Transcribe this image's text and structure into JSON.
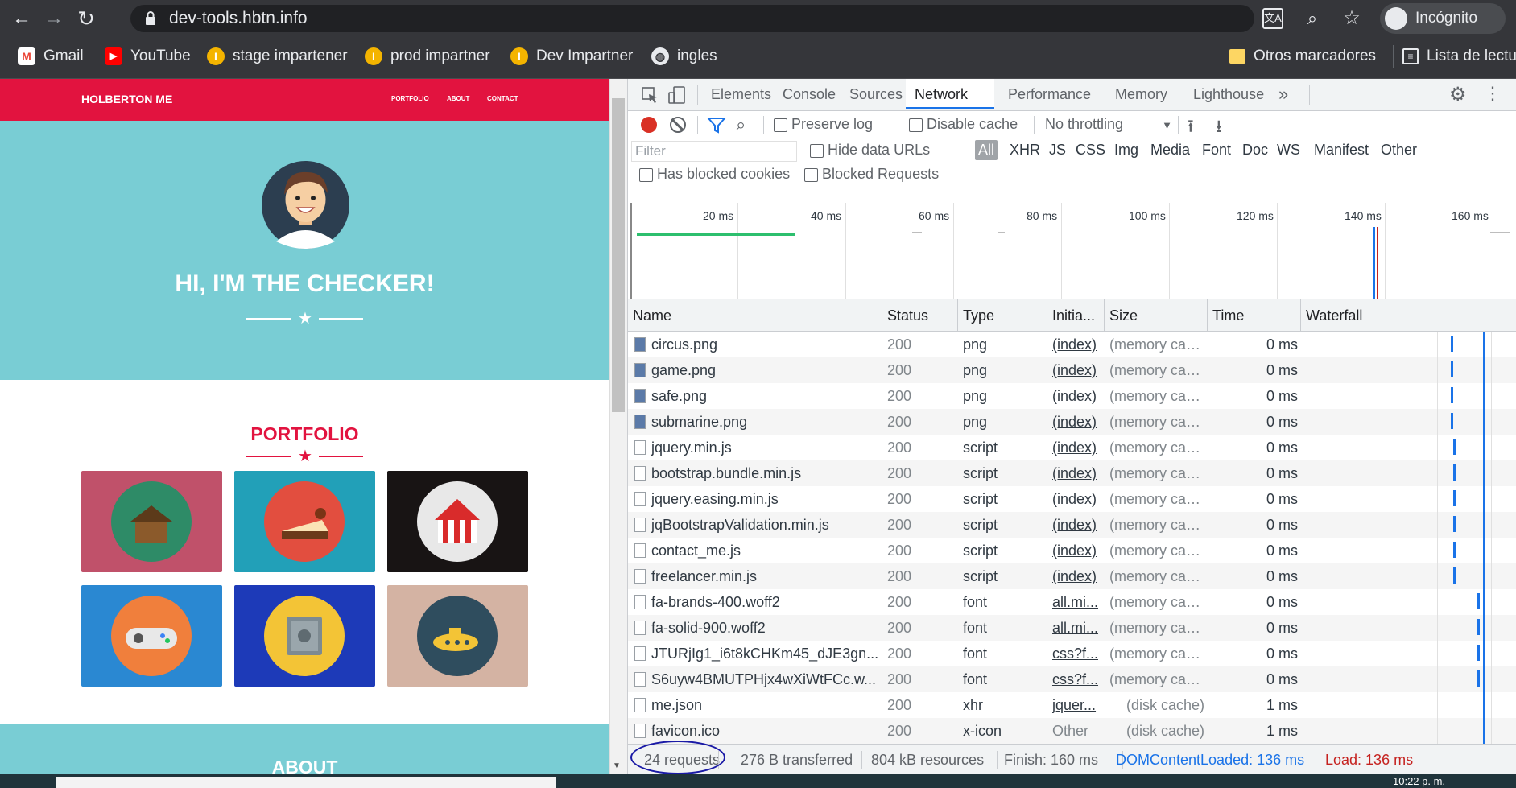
{
  "browser": {
    "url": "dev-tools.hbtn.info",
    "profile": "Incógnito",
    "bookmarks": [
      {
        "label": "Gmail",
        "icon": "gmail-icon"
      },
      {
        "label": "YouTube",
        "icon": "youtube-icon"
      },
      {
        "label": "stage impartener",
        "icon": "impartner-icon"
      },
      {
        "label": "prod impartner",
        "icon": "impartner-icon"
      },
      {
        "label": "Dev Impartner",
        "icon": "impartner-icon"
      },
      {
        "label": "ingles",
        "icon": "globe-icon"
      }
    ],
    "other_bookmarks": "Otros marcadores",
    "reading_list": "Lista de lectu"
  },
  "page": {
    "brand": "HOLBERTON ME",
    "nav": [
      "PORTFOLIO",
      "ABOUT",
      "CONTACT"
    ],
    "hero_title": "HI, I'M THE CHECKER!",
    "portfolio_title": "PORTFOLIO",
    "about_title": "ABOUT",
    "tiles": [
      {
        "name": "cabin",
        "bg": "#c0516a",
        "circle": "#2e8b67"
      },
      {
        "name": "cake",
        "bg": "#22a0b8",
        "circle": "#e24e3f"
      },
      {
        "name": "circus",
        "bg": "#181414",
        "circle": "#e8e8e8"
      },
      {
        "name": "game",
        "bg": "#2a88d2",
        "circle": "#f07f3c"
      },
      {
        "name": "safe",
        "bg": "#1d3ab8",
        "circle": "#f3c436"
      },
      {
        "name": "submarine",
        "bg": "#d4b3a3",
        "circle": "#2f4d5e"
      }
    ]
  },
  "devtools": {
    "tabs": [
      "Elements",
      "Console",
      "Sources",
      "Network",
      "Performance",
      "Memory",
      "Lighthouse"
    ],
    "active_tab": "Network",
    "more": "»",
    "preserve_log": "Preserve log",
    "disable_cache": "Disable cache",
    "throttling": "No throttling",
    "filter_placeholder": "Filter",
    "hide_data_urls": "Hide data URLs",
    "type_filters": [
      "All",
      "XHR",
      "JS",
      "CSS",
      "Img",
      "Media",
      "Font",
      "Doc",
      "WS",
      "Manifest",
      "Other"
    ],
    "has_blocked_cookies": "Has blocked cookies",
    "blocked_requests": "Blocked Requests",
    "overview_ticks": [
      "20 ms",
      "40 ms",
      "60 ms",
      "80 ms",
      "100 ms",
      "120 ms",
      "140 ms",
      "160 ms"
    ],
    "columns": [
      "Name",
      "Status",
      "Type",
      "Initia...",
      "Size",
      "Time",
      "Waterfall"
    ],
    "requests": [
      {
        "name": "circus.png",
        "status": "200",
        "type": "png",
        "initiator": "(index)",
        "size": "(memory cac...",
        "time": "0 ms",
        "icon": "image-file-icon",
        "wf": 0.3
      },
      {
        "name": "game.png",
        "status": "200",
        "type": "png",
        "initiator": "(index)",
        "size": "(memory cac...",
        "time": "0 ms",
        "icon": "image-file-icon",
        "wf": 0.3
      },
      {
        "name": "safe.png",
        "status": "200",
        "type": "png",
        "initiator": "(index)",
        "size": "(memory cac...",
        "time": "0 ms",
        "icon": "image-file-icon",
        "wf": 0.3
      },
      {
        "name": "submarine.png",
        "status": "200",
        "type": "png",
        "initiator": "(index)",
        "size": "(memory cac...",
        "time": "0 ms",
        "icon": "image-file-icon",
        "wf": 0.3
      },
      {
        "name": "jquery.min.js",
        "status": "200",
        "type": "script",
        "initiator": "(index)",
        "size": "(memory cac...",
        "time": "0 ms",
        "icon": "doc-file-icon",
        "wf": 0.31
      },
      {
        "name": "bootstrap.bundle.min.js",
        "status": "200",
        "type": "script",
        "initiator": "(index)",
        "size": "(memory cac...",
        "time": "0 ms",
        "icon": "doc-file-icon",
        "wf": 0.31
      },
      {
        "name": "jquery.easing.min.js",
        "status": "200",
        "type": "script",
        "initiator": "(index)",
        "size": "(memory cac...",
        "time": "0 ms",
        "icon": "doc-file-icon",
        "wf": 0.31
      },
      {
        "name": "jqBootstrapValidation.min.js",
        "status": "200",
        "type": "script",
        "initiator": "(index)",
        "size": "(memory cac...",
        "time": "0 ms",
        "icon": "doc-file-icon",
        "wf": 0.31
      },
      {
        "name": "contact_me.js",
        "status": "200",
        "type": "script",
        "initiator": "(index)",
        "size": "(memory cac...",
        "time": "0 ms",
        "icon": "doc-file-icon",
        "wf": 0.31
      },
      {
        "name": "freelancer.min.js",
        "status": "200",
        "type": "script",
        "initiator": "(index)",
        "size": "(memory cac...",
        "time": "0 ms",
        "icon": "doc-file-icon",
        "wf": 0.31
      },
      {
        "name": "fa-brands-400.woff2",
        "status": "200",
        "type": "font",
        "initiator": "all.mi...",
        "size": "(memory cac...",
        "time": "0 ms",
        "icon": "doc-file-icon",
        "wf": 0.42
      },
      {
        "name": "fa-solid-900.woff2",
        "status": "200",
        "type": "font",
        "initiator": "all.mi...",
        "size": "(memory cac...",
        "time": "0 ms",
        "icon": "doc-file-icon",
        "wf": 0.42
      },
      {
        "name": "JTURjIg1_i6t8kCHKm45_dJE3gn...",
        "status": "200",
        "type": "font",
        "initiator": "css?f...",
        "size": "(memory cac...",
        "time": "0 ms",
        "icon": "doc-file-icon",
        "wf": 0.42
      },
      {
        "name": "S6uyw4BMUTPHjx4wXiWtFCc.w...",
        "status": "200",
        "type": "font",
        "initiator": "css?f...",
        "size": "(memory cac...",
        "time": "0 ms",
        "icon": "doc-file-icon",
        "wf": 0.42
      },
      {
        "name": "me.json",
        "status": "200",
        "type": "xhr",
        "initiator": "jquer...",
        "size": "(disk cache)",
        "time": "1 ms",
        "icon": "doc-file-icon",
        "wf": null
      },
      {
        "name": "favicon.ico",
        "status": "200",
        "type": "x-icon",
        "initiator": "Other",
        "size": "(disk cache)",
        "time": "1 ms",
        "icon": "doc-file-icon",
        "wf": null
      }
    ],
    "footer": {
      "requests": "24 requests",
      "transferred": "276 B transferred",
      "resources": "804 kB resources",
      "finish": "Finish: 160 ms",
      "dcl": "DOMContentLoaded: 136 ms",
      "load": "Load: 136 ms"
    },
    "colors": {
      "accent": "#1a73e8",
      "record": "#d93025",
      "dcl": "#1a73e8",
      "load": "#c5221f",
      "annotation": "#1a1aa6"
    }
  },
  "taskbar": {
    "clock": "10:22 p. m."
  }
}
